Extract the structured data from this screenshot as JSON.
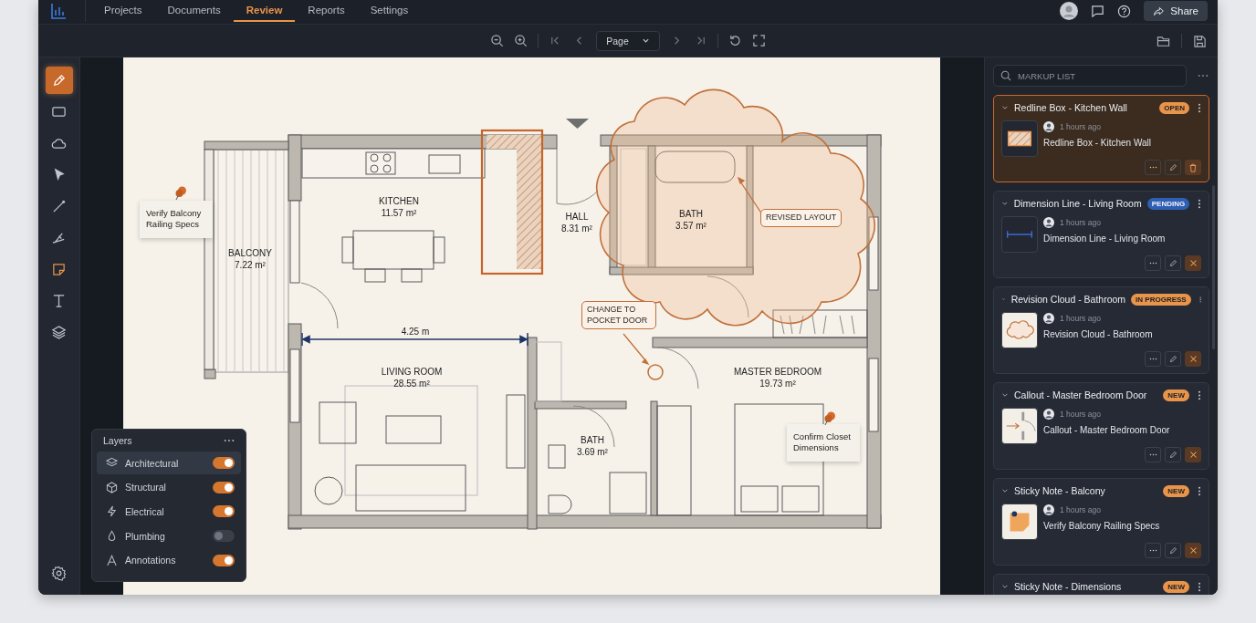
{
  "nav": {
    "tabs": [
      {
        "label": "Projects",
        "selected": false
      },
      {
        "label": "Documents",
        "selected": false
      },
      {
        "label": "Review",
        "selected": true
      },
      {
        "label": "Reports",
        "selected": false
      },
      {
        "label": "Settings",
        "selected": false
      }
    ],
    "share": "Share"
  },
  "toolbar": {
    "page_select": "Page"
  },
  "tools": [
    {
      "kind": "pen",
      "selected": true,
      "highlighted": false
    },
    {
      "kind": "rectangle",
      "selected": false,
      "highlighted": false
    },
    {
      "kind": "cloud",
      "selected": false,
      "highlighted": false
    },
    {
      "kind": "pointer",
      "selected": false,
      "highlighted": false
    },
    {
      "kind": "line",
      "selected": false,
      "highlighted": false
    },
    {
      "kind": "measure",
      "selected": false,
      "highlighted": false
    },
    {
      "kind": "sticky-note",
      "selected": false,
      "highlighted": true
    },
    {
      "kind": "text",
      "selected": false,
      "highlighted": false
    },
    {
      "kind": "layers",
      "selected": false,
      "highlighted": false
    }
  ],
  "plan": {
    "rooms": [
      {
        "name": "BALCONY",
        "area": "7.22 m²"
      },
      {
        "name": "KITCHEN",
        "area": "11.57 m²"
      },
      {
        "name": "HALL",
        "area": "8.31 m²"
      },
      {
        "name": "BATH",
        "area": "3.57 m²"
      },
      {
        "name": "LIVING ROOM",
        "area": "28.55 m²"
      },
      {
        "name": "BATH",
        "area": "3.69 m²"
      },
      {
        "name": "MASTER BEDROOM",
        "area": "19.73 m²"
      }
    ],
    "dimension": "4.25 m",
    "callouts": [
      {
        "text": "REVISED LAYOUT"
      },
      {
        "text": "CHANGE TO POCKET DOOR"
      }
    ],
    "notes": [
      {
        "text": "Verify Balcony Railing Specs"
      },
      {
        "text": "Confirm Closet Dimensions"
      }
    ]
  },
  "layers": {
    "title": "Layers",
    "items": [
      {
        "kind": "layers",
        "name": "Architectural",
        "on": true,
        "selected": true
      },
      {
        "kind": "cube",
        "name": "Structural",
        "on": true,
        "selected": false
      },
      {
        "kind": "bolt",
        "name": "Electrical",
        "on": true,
        "selected": false
      },
      {
        "kind": "drop",
        "name": "Plumbing",
        "on": false,
        "selected": false
      },
      {
        "kind": "letter",
        "name": "Annotations",
        "on": true,
        "selected": false
      }
    ]
  },
  "markup": {
    "placeholder": "MARKUP LIST",
    "items": [
      {
        "kind": "redline-box",
        "title": "Redline Box - Kitchen Wall",
        "status": "OPEN",
        "color": "#e8944a",
        "time": "1 hours ago",
        "description": "Redline Box - Kitchen Wall",
        "selected": true
      },
      {
        "kind": "dimension-line",
        "title": "Dimension Line - Living Room",
        "status": "PENDING",
        "color": "#2f5fb3",
        "time": "1 hours ago",
        "description": "Dimension Line - Living Room",
        "selected": false
      },
      {
        "kind": "revision-cloud",
        "title": "Revision Cloud - Bathroom",
        "status": "IN PROGRESS",
        "color": "#e8944a",
        "time": "1 hours ago",
        "description": "Revision Cloud - Bathroom",
        "selected": false
      },
      {
        "kind": "callout",
        "title": "Callout - Master Bedroom Door",
        "status": "NEW",
        "color": "#e8944a",
        "time": "1 hours ago",
        "description": "Callout - Master Bedroom Door",
        "selected": false
      },
      {
        "kind": "sticky-note",
        "title": "Sticky Note - Balcony",
        "status": "NEW",
        "color": "#e8944a",
        "time": "1 hours ago",
        "description": "Verify Balcony Railing Specs",
        "selected": false
      },
      {
        "title": "Sticky Note - Dimensions",
        "status": "NEW",
        "color": "#e8944a",
        "selected": false
      }
    ]
  }
}
